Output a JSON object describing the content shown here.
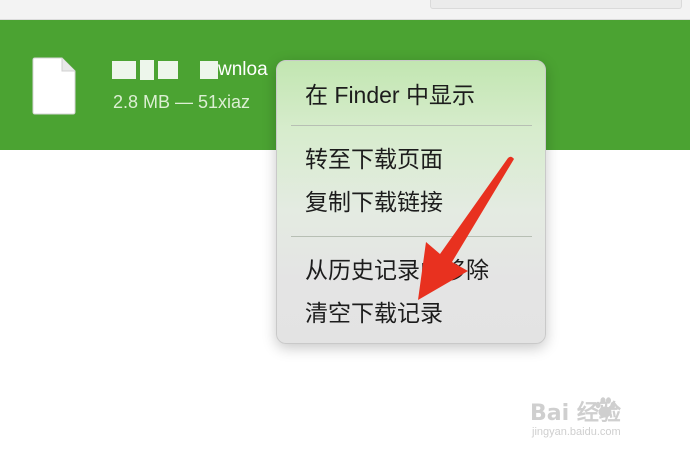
{
  "download": {
    "file_name_visible": "wnloa",
    "meta": "2.8 MB — 51xiaz"
  },
  "context_menu": {
    "show_in_finder": "在 Finder 中显示",
    "go_to_download_page": "转至下载页面",
    "copy_download_link": "复制下载链接",
    "remove_from_history": "从历史记录中移除",
    "clear_downloads": "清空下载记录"
  },
  "watermark": {
    "brand": "Bai  经验",
    "site": "jingyan.baidu.com"
  },
  "colors": {
    "row_highlight": "#4ba332",
    "arrow": "#e8311f"
  },
  "icons": {
    "file": "file-icon",
    "arrow": "red-arrow-annotation",
    "paw": "baidu-paw-icon"
  }
}
